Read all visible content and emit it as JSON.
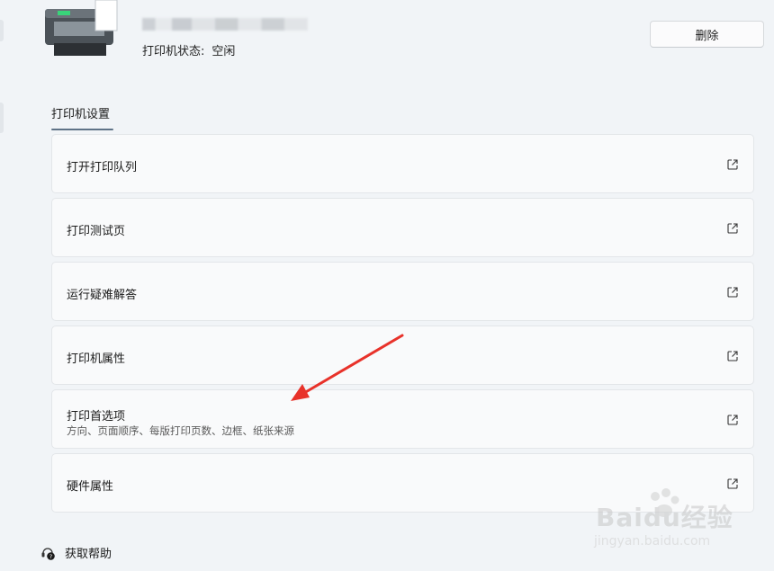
{
  "header": {
    "status_label": "打印机状态:",
    "status_value": "空闲",
    "delete_label": "删除"
  },
  "section": {
    "title": "打印机设置"
  },
  "items": [
    {
      "label": "打开打印队列"
    },
    {
      "label": "打印测试页"
    },
    {
      "label": "运行疑难解答"
    },
    {
      "label": "打印机属性"
    },
    {
      "label": "打印首选项",
      "subtitle": "方向、页面顺序、每版打印页数、边框、纸张来源"
    },
    {
      "label": "硬件属性"
    }
  ],
  "footer": {
    "help_label": "获取帮助"
  },
  "watermark": {
    "logo": "Baidu经验",
    "url": "jingyan.baidu.com"
  },
  "colors": {
    "background": "#f1f4f7",
    "card": "#f9fafb",
    "accent_underline": "#5f7387",
    "annotation_arrow": "#e8322a"
  }
}
